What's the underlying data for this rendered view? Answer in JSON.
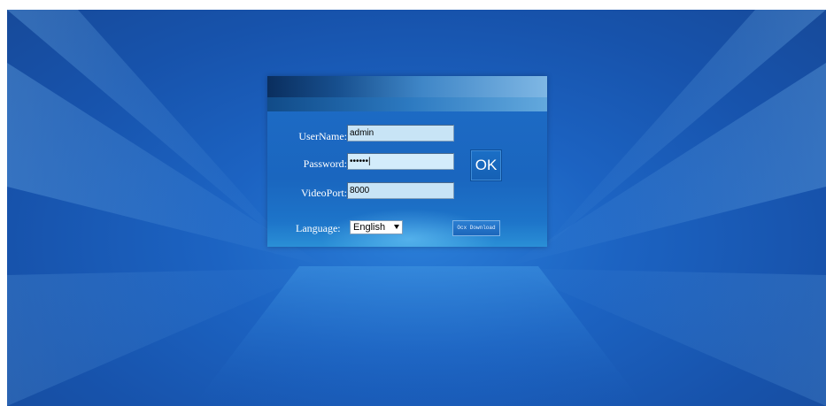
{
  "login": {
    "username_label": "UserName:",
    "username_value": "admin",
    "password_label": "Password:",
    "password_value": "••••••|",
    "videoport_label": "VideoPort:",
    "videoport_value": "8000",
    "ok_label": "OK",
    "language_label": "Language:",
    "language_selected": "English",
    "ocx_download_label": "Ocx Download"
  },
  "colors": {
    "background": "#1c63c2",
    "panel": "#1a66bf",
    "field_bg": "#c8e4f6",
    "text": "#ffffff"
  },
  "icons": {
    "language_dropdown": "chevron-down-icon"
  }
}
